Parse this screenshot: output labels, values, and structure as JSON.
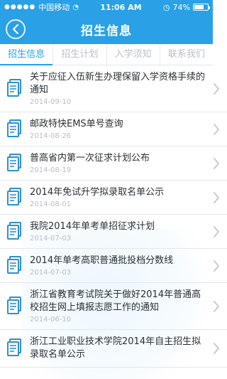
{
  "status": {
    "carrier": "中国移动",
    "time": "11:06 AM",
    "battery_text": "74%",
    "battery_level": 0.74
  },
  "nav": {
    "title": "招生信息"
  },
  "tabs": [
    {
      "label": "招生信息",
      "active": true
    },
    {
      "label": "招生计划",
      "active": false
    },
    {
      "label": "入学须知",
      "active": false
    },
    {
      "label": "联系我们",
      "active": false
    }
  ],
  "news": [
    {
      "title": "关于应征入伍新生办理保留入学资格手续的通知",
      "date": "2014-09-10"
    },
    {
      "title": "邮政特快EMS单号查询",
      "date": "2014-08-26"
    },
    {
      "title": "普高省内第一次征求计划公布",
      "date": "2014-08-19"
    },
    {
      "title": "2014年免试升学拟录取名单公示",
      "date": "2014-08-01"
    },
    {
      "title": "我院2014年单考单招征求计划",
      "date": "2014-07-03"
    },
    {
      "title": "2014年单考高职普通批投档分数线",
      "date": "2014-07-03"
    },
    {
      "title": "浙江省教育考试院关于做好2014年普通高校招生网上填报志愿工作的通知",
      "date": "2014-06-10"
    },
    {
      "title": "浙江工业职业技术学院2014年自主招生拟录取名单公示",
      "date": ""
    }
  ],
  "colors": {
    "accent": "#2aa0e6",
    "icon": "#2d8fd0"
  }
}
